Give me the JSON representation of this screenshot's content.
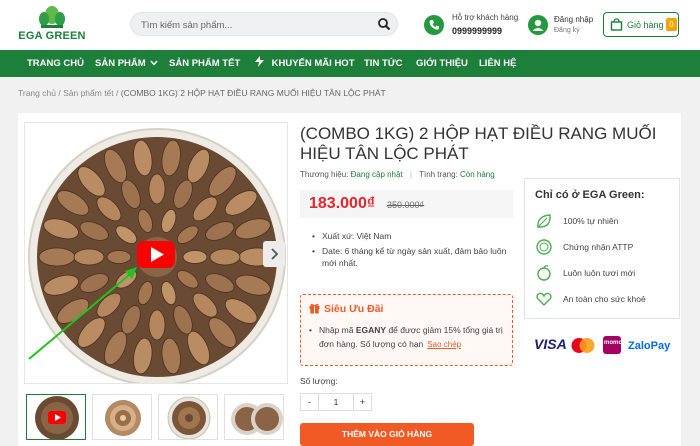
{
  "header": {
    "logo_text": "EGA GREEN",
    "search_placeholder": "Tìm kiếm sản phẩm...",
    "hotline_label": "Hỗ trợ khách hàng",
    "hotline_number": "0999999999",
    "login_label": "Đăng nhập",
    "register_label": "Đăng ký",
    "cart_label": "Giỏ hàng",
    "cart_count": "0",
    "brand_color": "#1e7f3a"
  },
  "nav": {
    "items": [
      {
        "label": "TRANG CHỦ"
      },
      {
        "label": "SẢN PHẨM"
      },
      {
        "label": "SẢN PHẨM TẾT"
      },
      {
        "label": "KHUYẾN MÃI HOT"
      },
      {
        "label": "TIN TỨC"
      },
      {
        "label": "GIỚI THIỆU"
      },
      {
        "label": "LIÊN HỆ"
      }
    ]
  },
  "breadcrumb": {
    "home": "Trang chủ",
    "category": "Sản phẩm tết",
    "current": "(COMBO 1KG) 2 HỘP HẠT ĐIỀU RANG MUỐI HIỆU TÂN LỘC PHÁT"
  },
  "product": {
    "title": "(COMBO 1KG) 2 HỘP HẠT ĐIỀU RANG MUỐI HIỆU TÂN LỘC PHÁT",
    "brand_label": "Thương hiệu:",
    "brand_value": "Đang cập nhật",
    "status_label": "Tình trạng:",
    "status_value": "Còn hàng",
    "price": "183.000₫",
    "old_price": "350.000₫",
    "bullets": [
      "Xuất xứ: Việt Nam",
      "Date: 6 tháng kể từ ngày sản xuất, đảm bảo luôn mới nhất."
    ],
    "promo_title": "Siêu Ưu Đãi",
    "promo_pre": "Nhập mã ",
    "promo_code": "EGANY",
    "promo_post": " để được giảm 15% tổng giá trị đơn hàng. Số lượng có hạn",
    "promo_copy": "Sao chép",
    "qty_label": "Số lượng:",
    "qty_value": "1",
    "qty_minus": "-",
    "qty_plus": "+",
    "add_to_cart": "THÊM VÀO GIỎ HÀNG",
    "price_color": "#e8242c",
    "accent_color": "#f15a24"
  },
  "side": {
    "title": "Chỉ có ở EGA Green:",
    "items": [
      {
        "label": "100% tự nhiên",
        "icon": "leaf-icon"
      },
      {
        "label": "Chứng nhận ATTP",
        "icon": "certificate-icon"
      },
      {
        "label": "Luôn luôn tươi mới",
        "icon": "fresh-icon"
      },
      {
        "label": "An toàn cho sức khoẻ",
        "icon": "heart-health-icon"
      }
    ]
  },
  "payments": [
    "VISA",
    "momo",
    "ZaloPay"
  ]
}
